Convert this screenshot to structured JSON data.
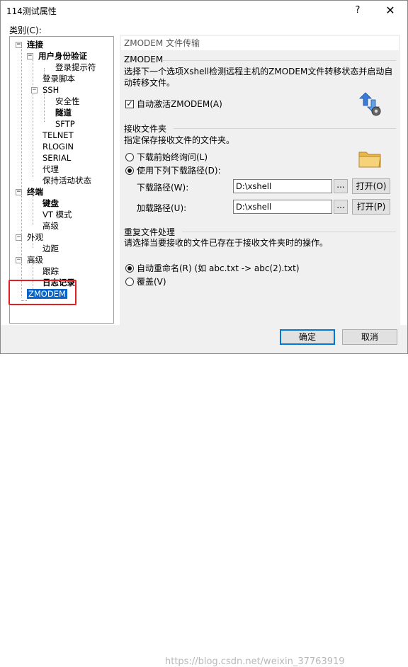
{
  "window": {
    "title": "114测试属性",
    "help": "?",
    "close": "✕"
  },
  "category_label": "类别(C):",
  "tree": {
    "items": [
      {
        "label": "连接",
        "toggle": "−"
      },
      {
        "label": "用户身份验证",
        "toggle": "−"
      },
      {
        "label": "登录提示符"
      },
      {
        "label": "登录脚本"
      },
      {
        "label": "SSH",
        "toggle": "−"
      },
      {
        "label": "安全性"
      },
      {
        "label": "隧道"
      },
      {
        "label": "SFTP"
      },
      {
        "label": "TELNET"
      },
      {
        "label": "RLOGIN"
      },
      {
        "label": "SERIAL"
      },
      {
        "label": "代理"
      },
      {
        "label": "保持活动状态"
      },
      {
        "label": "终端",
        "toggle": "−"
      },
      {
        "label": "键盘"
      },
      {
        "label": "VT 模式"
      },
      {
        "label": "高级"
      },
      {
        "label": "外观",
        "toggle": "−"
      },
      {
        "label": "边距"
      },
      {
        "label": "高级",
        "toggle": "−"
      },
      {
        "label": "跟踪"
      },
      {
        "label": "日志记录"
      },
      {
        "label": "ZMODEM"
      }
    ]
  },
  "panel": {
    "header": "ZMODEM 文件传输",
    "zmodem_section": {
      "title": "ZMODEM",
      "description": "选择下一个选项Xshell检测远程主机的ZMODEM文件转移状态并启动自动转移文件。",
      "auto_activate_label": "自动激活ZMODEM(A)",
      "auto_activate_checked": true
    },
    "receive_section": {
      "title": "接收文件夹",
      "description": "指定保存接收文件的文件夹。",
      "always_ask_label": "下载前始终询问(L)",
      "use_path_label": "使用下列下载路径(D):",
      "selected_option": "use_path",
      "download_path_label": "下载路径(W):",
      "download_path_value": "D:\\xshell",
      "upload_path_label": "加载路径(U):",
      "upload_path_value": "D:\\xshell",
      "ellipsis": "...",
      "open_o_label": "打开(O)",
      "open_p_label": "打开(P)"
    },
    "duplicate_section": {
      "title": "重复文件处理",
      "description": "请选择当要接收的文件已存在于接收文件夹时的操作。",
      "auto_rename_label": "自动重命名(R) (如 abc.txt -> abc(2).txt)",
      "overwrite_label": "覆盖(V)",
      "selected_option": "auto_rename"
    }
  },
  "footer": {
    "ok_label": "确定",
    "cancel_label": "取消",
    "watermark": "https://blog.csdn.net/weixin_37763919"
  },
  "colors": {
    "selection": "#0a64c8",
    "highlight_box": "#e02020",
    "default_button_border": "#0078d7"
  }
}
